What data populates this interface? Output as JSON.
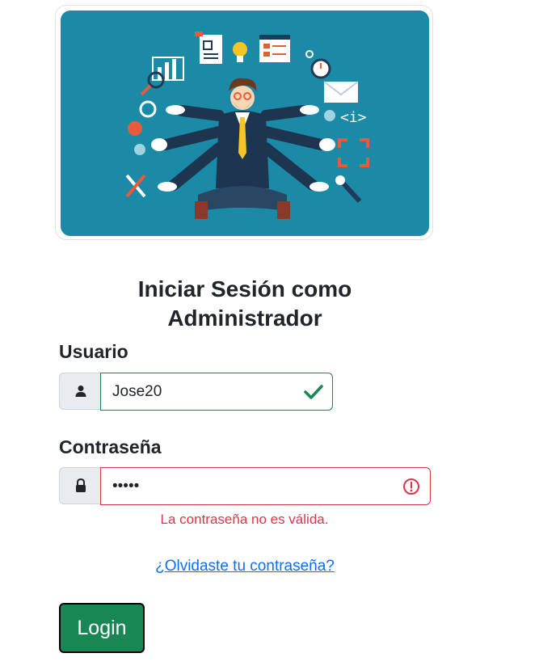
{
  "hero": {
    "image_name": "multitasking-businessman-illustration"
  },
  "title": {
    "line1": "Iniciar Sesión como",
    "line2": "Administrador"
  },
  "username": {
    "label": "Usuario",
    "value": "Jose20",
    "state": "valid",
    "icon": "person-icon"
  },
  "password": {
    "label": "Contraseña",
    "value": "12345",
    "state": "invalid",
    "icon": "lock-icon",
    "error": "La contraseña no es válida."
  },
  "forgot_link": "¿Olvidaste tu contraseña?",
  "login_button": "Login",
  "colors": {
    "success": "#198754",
    "danger": "#dc3545",
    "link": "#0d6efd",
    "hero_bg": "#1b8aa6"
  }
}
